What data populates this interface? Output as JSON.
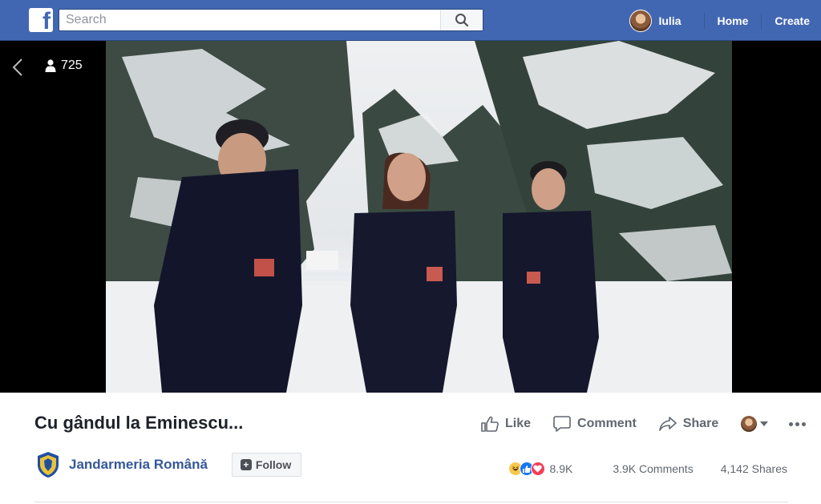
{
  "header": {
    "search_placeholder": "Search",
    "user_name": "Iulia",
    "home_label": "Home",
    "create_label": "Create",
    "brand_color": "#4267b2"
  },
  "video": {
    "viewer_count": "725"
  },
  "post": {
    "title": "Cu gândul la Eminescu...",
    "actions": {
      "like": "Like",
      "comment": "Comment",
      "share": "Share"
    },
    "page_name": "Jandarmeria Română",
    "follow_label": "Follow",
    "reactions_count": "8.9K",
    "comments_count": "3.9K Comments",
    "shares_count": "4,142 Shares",
    "reaction_icons": [
      "haha-icon",
      "like-icon",
      "love-icon"
    ]
  }
}
